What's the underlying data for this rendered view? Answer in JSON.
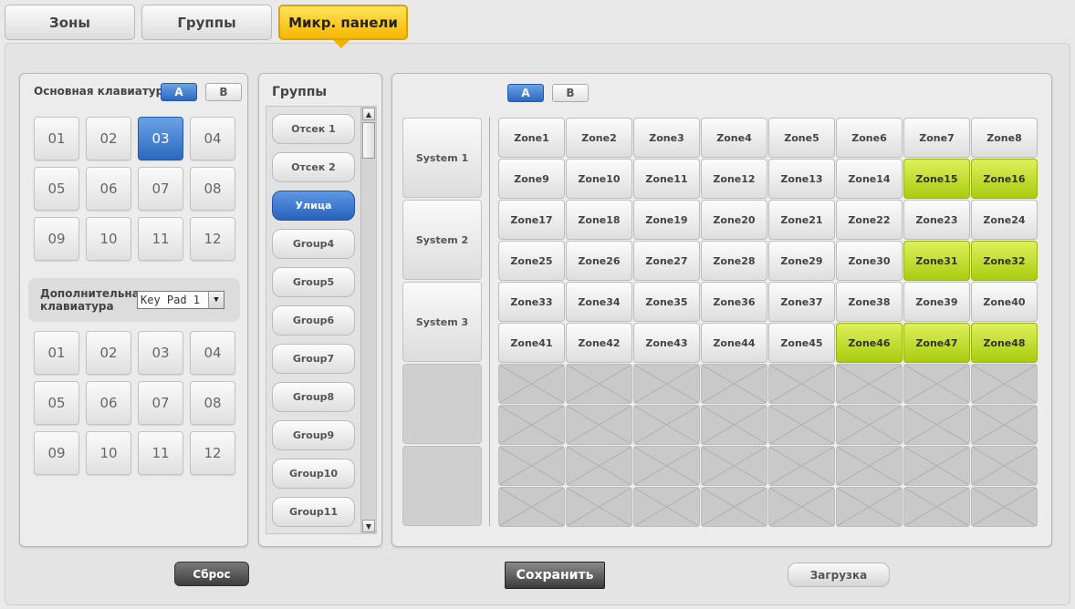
{
  "tabs": [
    {
      "label": "Зоны",
      "active": false
    },
    {
      "label": "Группы",
      "active": false
    },
    {
      "label": "Микр. панели",
      "active": true
    }
  ],
  "keypad": {
    "title": "Основная клавиатура",
    "ab": [
      "A",
      "B"
    ],
    "ab_active": "A",
    "main_keys": [
      "01",
      "02",
      "03",
      "04",
      "05",
      "06",
      "07",
      "08",
      "09",
      "10",
      "11",
      "12"
    ],
    "main_selected": "03",
    "aux_label": "Дополнительная клавиатура",
    "aux_select_value": "Key Pad 1",
    "aux_keys": [
      "01",
      "02",
      "03",
      "04",
      "05",
      "06",
      "07",
      "08",
      "09",
      "10",
      "11",
      "12"
    ]
  },
  "groups": {
    "title": "Группы",
    "items": [
      "Отсек 1",
      "Отсек 2",
      "Улица",
      "Group4",
      "Group5",
      "Group6",
      "Group7",
      "Group8",
      "Group9",
      "Group10",
      "Group11"
    ],
    "selected": "Улица"
  },
  "zones_panel": {
    "ab": [
      "A",
      "B"
    ],
    "ab_active": "A",
    "systems": [
      "System 1",
      "System 2",
      "System 3"
    ],
    "zones": [
      "Zone1",
      "Zone2",
      "Zone3",
      "Zone4",
      "Zone5",
      "Zone6",
      "Zone7",
      "Zone8",
      "Zone9",
      "Zone10",
      "Zone11",
      "Zone12",
      "Zone13",
      "Zone14",
      "Zone15",
      "Zone16",
      "Zone17",
      "Zone18",
      "Zone19",
      "Zone20",
      "Zone21",
      "Zone22",
      "Zone23",
      "Zone24",
      "Zone25",
      "Zone26",
      "Zone27",
      "Zone28",
      "Zone29",
      "Zone30",
      "Zone31",
      "Zone32",
      "Zone33",
      "Zone34",
      "Zone35",
      "Zone36",
      "Zone37",
      "Zone38",
      "Zone39",
      "Zone40",
      "Zone41",
      "Zone42",
      "Zone43",
      "Zone44",
      "Zone45",
      "Zone46",
      "Zone47",
      "Zone48"
    ],
    "active_zones": [
      "Zone15",
      "Zone16",
      "Zone31",
      "Zone32",
      "Zone46",
      "Zone47",
      "Zone48"
    ]
  },
  "footer": {
    "reset_label": "Сброс",
    "save_label": "Сохранить",
    "load_label": "Загрузка"
  },
  "colors": {
    "tab_active": "#f5b800",
    "selected_blue": "#2c68c0",
    "zone_active": "#a9cc10"
  }
}
